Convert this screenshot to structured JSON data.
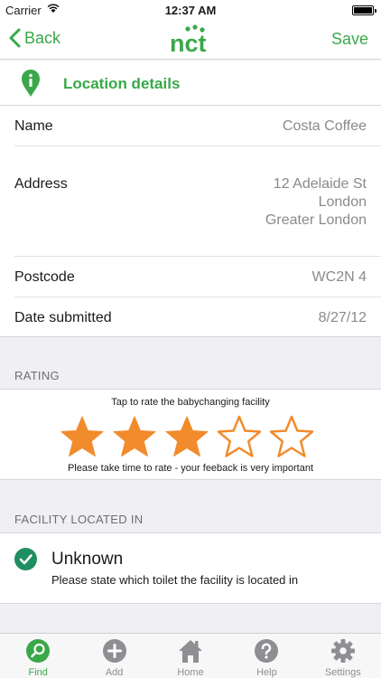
{
  "status_bar": {
    "carrier": "Carrier",
    "time": "12:37 AM"
  },
  "nav": {
    "back_label": "Back",
    "logo_text": "nct",
    "save_label": "Save"
  },
  "section": {
    "title": "Location details"
  },
  "details": {
    "name_label": "Name",
    "name_value": "Costa Coffee",
    "address_label": "Address",
    "address_line1": "12 Adelaide St",
    "address_line2": "London",
    "address_line3": "Greater London",
    "postcode_label": "Postcode",
    "postcode_value": "WC2N 4",
    "date_label": "Date submitted",
    "date_value": "8/27/12"
  },
  "rating": {
    "header": "RATING",
    "prompt": "Tap to rate the babychanging facility",
    "note": "Please take time to rate - your feeback is very important",
    "value": 3,
    "max": 5
  },
  "facility": {
    "header": "FACILITY LOCATED IN",
    "name": "Unknown",
    "hint": "Please state which toilet the facility is located in"
  },
  "tabs": [
    {
      "label": "Find",
      "icon": "search-icon",
      "active": true
    },
    {
      "label": "Add",
      "icon": "add-icon",
      "active": false
    },
    {
      "label": "Home",
      "icon": "home-icon",
      "active": false
    },
    {
      "label": "Help",
      "icon": "help-icon",
      "active": false
    },
    {
      "label": "Settings",
      "icon": "gear-icon",
      "active": false
    }
  ],
  "colors": {
    "accent": "#3aa84a",
    "star": "#f28b2c"
  }
}
